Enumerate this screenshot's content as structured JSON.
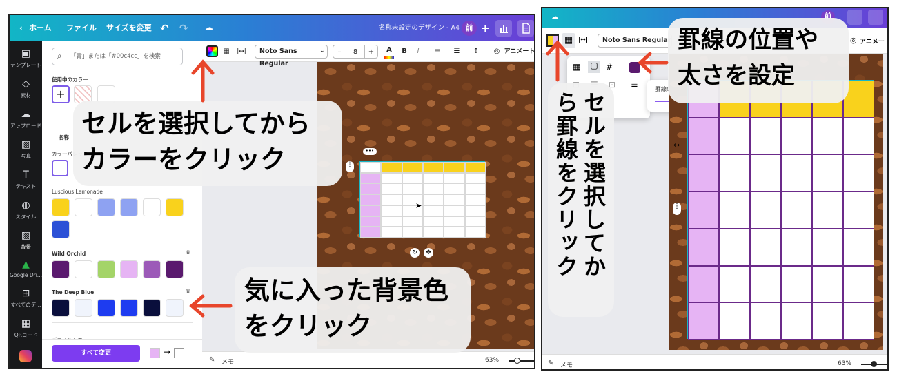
{
  "left": {
    "topbar": {
      "home": "ホーム",
      "file": "ファイル",
      "resize": "サイズを変更",
      "doc_title": "名称未設定のデザイン - A4",
      "avatar": "前"
    },
    "rail": [
      {
        "label": "テンプレート",
        "icon": "template-icon"
      },
      {
        "label": "素材",
        "icon": "elements-icon"
      },
      {
        "label": "アップロード",
        "icon": "upload-icon"
      },
      {
        "label": "写真",
        "icon": "photo-icon"
      },
      {
        "label": "テキスト",
        "icon": "text-icon"
      },
      {
        "label": "スタイル",
        "icon": "style-icon"
      },
      {
        "label": "背景",
        "icon": "background-icon"
      },
      {
        "label": "Google Dri...",
        "icon": "drive-icon"
      },
      {
        "label": "すべてのデ...",
        "icon": "apps-icon"
      },
      {
        "label": "QRコード",
        "icon": "qr-icon"
      }
    ],
    "side": {
      "search_placeholder": "「青」または「#00c4cc」を検索",
      "in_use": "使用中のカラー",
      "fragment1": "名称",
      "color_palette": "カラーパレット",
      "luscious": "Luscious Lemonade",
      "wild_orchid": "Wild Orchid",
      "deep_blue": "The Deep Blue",
      "default_colors": "デフォルトカラー",
      "apply_all": "すべて変更"
    },
    "palettes": {
      "luscious": [
        "#f9d21c",
        "#ffffff",
        "#8ea2f2",
        "#8ea2f2",
        "#ffffff",
        "#f9d21c",
        "#2c51d6"
      ],
      "wild_orchid": [
        "#5a1a6e",
        "#ffffff",
        "#a4d468",
        "#e6b4f4",
        "#9c5ab8",
        "#5a1a6e"
      ],
      "deep_blue": [
        "#0a0f3c",
        "#f0f4fc",
        "#1e3cf0",
        "#1e3cf0",
        "#0a0f3c",
        "#f0f4fc"
      ],
      "defaults": [
        "#000000",
        "#444444",
        "#666666",
        "#999999",
        "#bbbbbb",
        "#dddddd"
      ]
    },
    "toolbar": {
      "font": "Noto Sans Regular",
      "minus": "–",
      "size": "8",
      "plus": "+",
      "bold": "B",
      "italic": "I",
      "animate": "アニメート"
    },
    "bottom": {
      "notes": "メモ",
      "zoom": "63%"
    },
    "callout1_line1": "セルを選択してから",
    "callout1_line2": "カラーをクリック",
    "callout2_line1": "気に入った背景色",
    "callout2_line2": "をクリック"
  },
  "right": {
    "toolbar": {
      "font": "Noto Sans Regular",
      "animate": "アニメー"
    },
    "popup": {
      "border_label": "罫線の太さ"
    },
    "bottom": {
      "notes": "メモ",
      "zoom": "63%"
    },
    "callout_vertical_col1": "セルを選択してか",
    "callout_vertical_col2": "ら罫線をクリック",
    "callout_top_line1": "罫線の位置や",
    "callout_top_line2": "太さを設定"
  },
  "colors": {
    "accent_arrow": "#e8462b",
    "table_header": "#f9d21c",
    "table_side": "#e6b4f4",
    "border": "#6b2a8a"
  }
}
